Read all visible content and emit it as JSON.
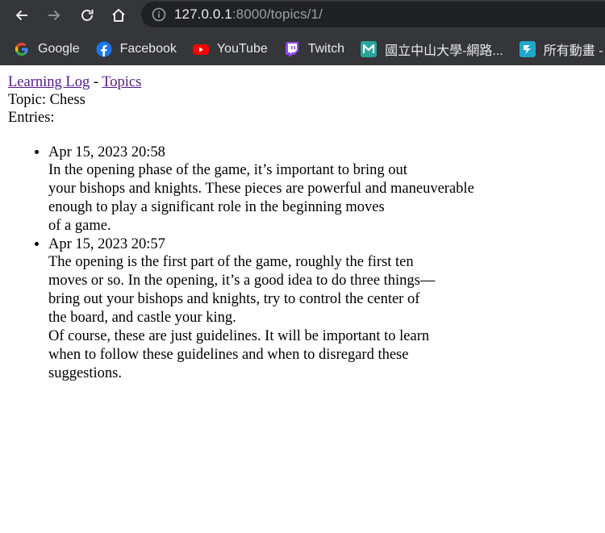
{
  "browser": {
    "url_host": "127.0.0.1",
    "url_rest": ":8000/topics/1/",
    "bookmarks": [
      {
        "label": "Google",
        "icon": "google-icon"
      },
      {
        "label": "Facebook",
        "icon": "facebook-icon"
      },
      {
        "label": "YouTube",
        "icon": "youtube-icon"
      },
      {
        "label": "Twitch",
        "icon": "twitch-icon"
      },
      {
        "label": "國立中山大學-網路...",
        "icon": "moodle-icon"
      },
      {
        "label": "所有動畫 - 巴",
        "icon": "bahamut-icon"
      }
    ]
  },
  "page": {
    "site_link": "Learning Log",
    "separator": " - ",
    "topics_link": "Topics",
    "topic_line": "Topic: Chess",
    "entries_label": "Entries:",
    "entries": [
      {
        "date": "Apr 15, 2023 20:58",
        "lines": [
          "In the opening phase of the game, it’s important to bring out",
          "your bishops and knights. These pieces are powerful and maneuverable",
          "enough to play a significant role in the beginning moves",
          "of a game."
        ]
      },
      {
        "date": "Apr 15, 2023 20:57",
        "lines": [
          "The opening is the first part of the game, roughly the first ten",
          "moves or so. In the opening, it’s a good idea to do three things—",
          "bring out your bishops and knights, try to control the center of",
          "the board, and castle your king.",
          "Of course, these are just guidelines. It will be important to learn",
          "when to follow these guidelines and when to disregard these",
          "suggestions."
        ]
      }
    ]
  },
  "colors": {
    "chrome_bg": "#35363a",
    "omnibox_bg": "#202124",
    "link_visited": "#551a8b"
  }
}
